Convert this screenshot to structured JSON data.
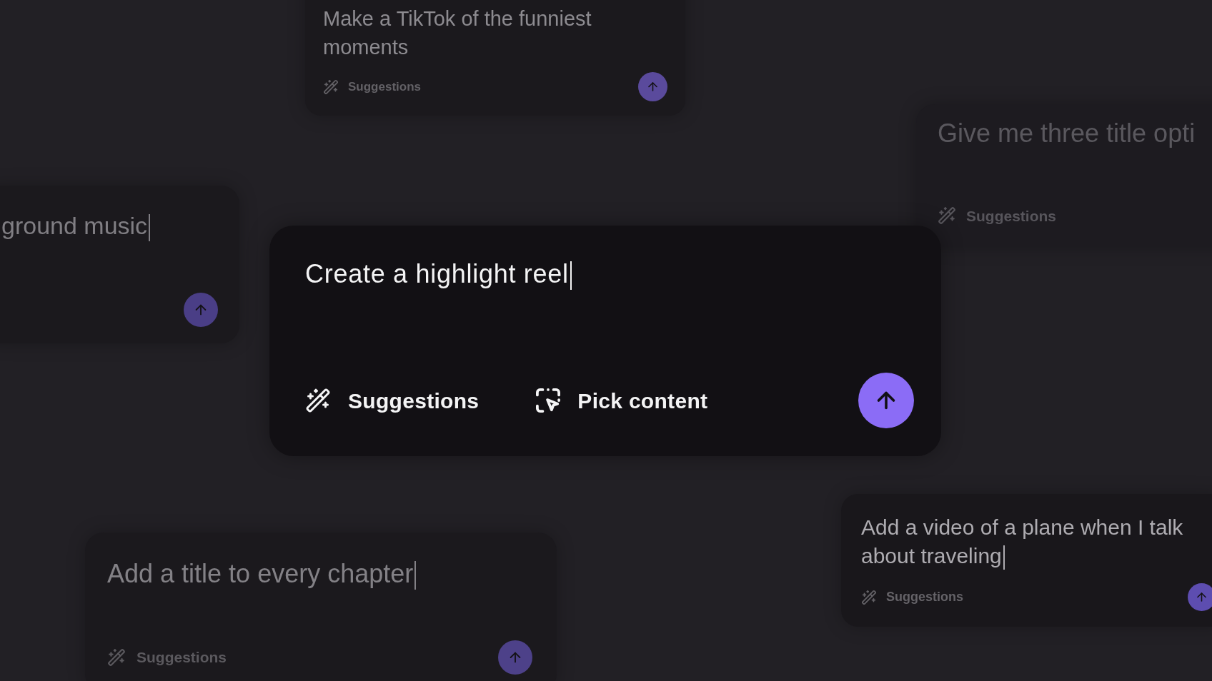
{
  "background_prompts": [
    {
      "value": "Make a TikTok of the funniest moments",
      "cursor": false,
      "suggestions": "Suggestions"
    },
    {
      "value": "Give me three title opti",
      "cursor": false,
      "suggestions": "Suggestions"
    },
    {
      "value": "ground music",
      "cursor": true
    },
    {
      "value": "Add a video of a plane when I talk about traveling",
      "cursor": true,
      "suggestions": "Suggestions"
    },
    {
      "value": "Add a title to every chapter",
      "cursor": true,
      "suggestions": "Suggestions"
    }
  ],
  "composer": {
    "value": "Create a highlight reel",
    "cursor": true,
    "actions": [
      {
        "kind": "suggestions",
        "label": "Suggestions"
      },
      {
        "kind": "pick_content",
        "label": "Pick content"
      }
    ]
  }
}
